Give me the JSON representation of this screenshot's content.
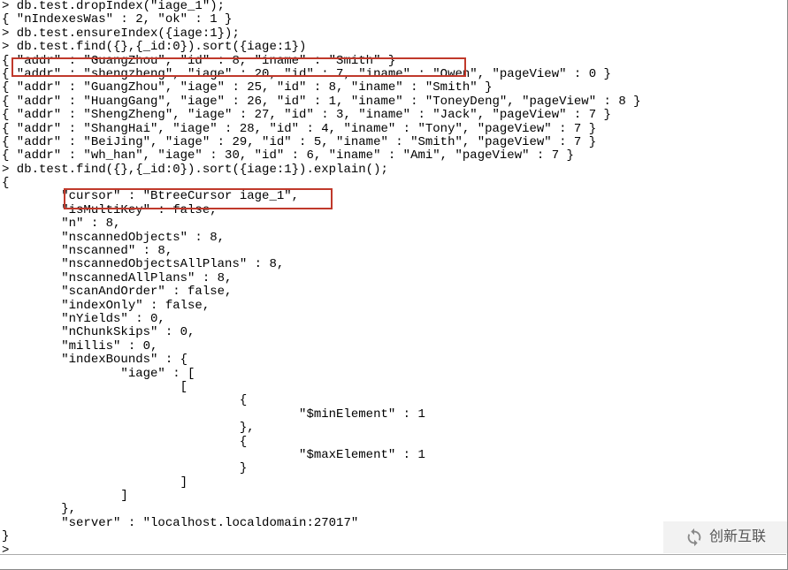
{
  "lines": {
    "l01": "> db.test.dropIndex(\"iage_1\");",
    "l02": "{ \"nIndexesWas\" : 2, \"ok\" : 1 }",
    "l03": "> db.test.ensureIndex({iage:1});",
    "l04": "> db.test.find({},{_id:0}).sort({iage:1})",
    "l05": "{ \"addr\" : \"GuangZhou\", \"id\" : 8, \"iname\" : \"Smith\" }",
    "l06": "{ \"addr\" : \"shengzheng\", \"iage\" : 20, \"id\" : 7, \"iname\" : \"Owen\", \"pageView\" : 0 }",
    "l07": "{ \"addr\" : \"GuangZhou\", \"iage\" : 25, \"id\" : 8, \"iname\" : \"Smith\" }",
    "l08": "{ \"addr\" : \"HuangGang\", \"iage\" : 26, \"id\" : 1, \"iname\" : \"ToneyDeng\", \"pageView\" : 8 }",
    "l09": "{ \"addr\" : \"ShengZheng\", \"iage\" : 27, \"id\" : 3, \"iname\" : \"Jack\", \"pageView\" : 7 }",
    "l10": "{ \"addr\" : \"ShangHai\", \"iage\" : 28, \"id\" : 4, \"iname\" : \"Tony\", \"pageView\" : 7 }",
    "l11": "{ \"addr\" : \"BeiJing\", \"iage\" : 29, \"id\" : 5, \"iname\" : \"Smith\", \"pageView\" : 7 }",
    "l12": "{ \"addr\" : \"wh_han\", \"iage\" : 30, \"id\" : 6, \"iname\" : \"Ami\", \"pageView\" : 7 }",
    "l13": "> db.test.find({},{_id:0}).sort({iage:1}).explain();",
    "l14": "{",
    "l15": "        \"cursor\" : \"BtreeCursor iage_1\",",
    "l16": "        \"isMultiKey\" : false,",
    "l17": "        \"n\" : 8,",
    "l18": "        \"nscannedObjects\" : 8,",
    "l19": "        \"nscanned\" : 8,",
    "l20": "        \"nscannedObjectsAllPlans\" : 8,",
    "l21": "        \"nscannedAllPlans\" : 8,",
    "l22": "        \"scanAndOrder\" : false,",
    "l23": "        \"indexOnly\" : false,",
    "l24": "        \"nYields\" : 0,",
    "l25": "        \"nChunkSkips\" : 0,",
    "l26": "        \"millis\" : 0,",
    "l27": "        \"indexBounds\" : {",
    "l28": "                \"iage\" : [",
    "l29": "                        [",
    "l30": "                                {",
    "l31": "                                        \"$minElement\" : 1",
    "l32": "                                },",
    "l33": "                                {",
    "l34": "                                        \"$maxElement\" : 1",
    "l35": "                                }",
    "l36": "                        ]",
    "l37": "                ]",
    "l38": "        },",
    "l39": "        \"server\" : \"localhost.localdomain:27017\"",
    "l40": "}",
    "l41": ">"
  },
  "watermark": {
    "text": "创新互联"
  }
}
